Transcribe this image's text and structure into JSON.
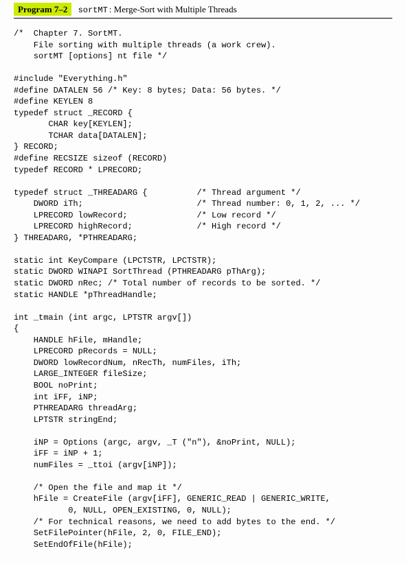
{
  "header": {
    "program_label": "Program 7–2",
    "program_code": "sortMT",
    "program_title": ": Merge-Sort with Multiple Threads"
  },
  "code": "/*  Chapter 7. SortMT.\n    File sorting with multiple threads (a work crew).\n    sortMT [options] nt file */\n\n#include \"Everything.h\"\n#define DATALEN 56 /* Key: 8 bytes; Data: 56 bytes. */\n#define KEYLEN 8\ntypedef struct _RECORD {\n       CHAR key[KEYLEN];\n       TCHAR data[DATALEN];\n} RECORD;\n#define RECSIZE sizeof (RECORD)\ntypedef RECORD * LPRECORD;\n\ntypedef struct _THREADARG {          /* Thread argument */\n    DWORD iTh;                       /* Thread number: 0, 1, 2, ... */\n    LPRECORD lowRecord;              /* Low record */\n    LPRECORD highRecord;             /* High record */\n} THREADARG, *PTHREADARG;\n\nstatic int KeyCompare (LPCTSTR, LPCTSTR);\nstatic DWORD WINAPI SortThread (PTHREADARG pThArg);\nstatic DWORD nRec; /* Total number of records to be sorted. */\nstatic HANDLE *pThreadHandle;\n\nint _tmain (int argc, LPTSTR argv[])\n{\n    HANDLE hFile, mHandle;\n    LPRECORD pRecords = NULL;\n    DWORD lowRecordNum, nRecTh, numFiles, iTh;\n    LARGE_INTEGER fileSize;\n    BOOL noPrint;\n    int iFF, iNP;\n    PTHREADARG threadArg;\n    LPTSTR stringEnd;\n\n    iNP = Options (argc, argv, _T (\"n\"), &noPrint, NULL);\n    iFF = iNP + 1;\n    numFiles = _ttoi (argv[iNP]);\n\n    /* Open the file and map it */\n    hFile = CreateFile (argv[iFF], GENERIC_READ | GENERIC_WRITE,\n           0, NULL, OPEN_EXISTING, 0, NULL);\n    /* For technical reasons, we need to add bytes to the end. */\n    SetFilePointer(hFile, 2, 0, FILE_END);\n    SetEndOfFile(hFile);"
}
